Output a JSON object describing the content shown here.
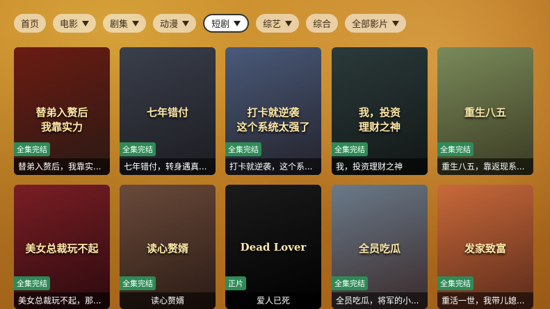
{
  "nav": {
    "tabs": [
      {
        "label": "首页",
        "dropdown": false,
        "active": false
      },
      {
        "label": "电影",
        "dropdown": true,
        "active": false
      },
      {
        "label": "剧集",
        "dropdown": true,
        "active": false
      },
      {
        "label": "动漫",
        "dropdown": true,
        "active": false
      },
      {
        "label": "短剧",
        "dropdown": true,
        "active": true
      },
      {
        "label": "综艺",
        "dropdown": true,
        "active": false
      },
      {
        "label": "综合",
        "dropdown": false,
        "active": false
      },
      {
        "label": "全部影片",
        "dropdown": true,
        "active": false
      }
    ]
  },
  "cards": [
    {
      "status": "全集完结",
      "title": "替弟入赘后，我靠实...",
      "poster_text": "替弟入赘后\n我靠实力",
      "colors": [
        "#6b1b12",
        "#2a1a14"
      ]
    },
    {
      "status": "全集完结",
      "title": "七年错付，转身遇真...",
      "poster_text": "七年错付",
      "colors": [
        "#3a3f4a",
        "#1c1c22"
      ]
    },
    {
      "status": "全集完结",
      "title": "打卡就逆袭，这个系...",
      "poster_text": "打卡就逆袭\n这个系统太强了",
      "colors": [
        "#4a5a7a",
        "#23222a"
      ]
    },
    {
      "status": "全集完结",
      "title": "我，投资理财之神",
      "poster_text": "我，投资\n理财之神",
      "colors": [
        "#2b3a3a",
        "#121616"
      ]
    },
    {
      "status": "全集完结",
      "title": "重生八五，靠返现系...",
      "poster_text": "重生八五",
      "colors": [
        "#7a8a5a",
        "#3a3a22"
      ]
    },
    {
      "status": "全集完结",
      "title": "美女总裁玩不起，那...",
      "poster_text": "美女总裁玩不起",
      "colors": [
        "#7a1e24",
        "#2a0a0e"
      ]
    },
    {
      "status": "全集完结",
      "title": "读心赘婿",
      "poster_text": "读心赘婿",
      "colors": [
        "#6a4a3a",
        "#2a1a14"
      ]
    },
    {
      "status": "正片",
      "title": "爱人已死",
      "poster_text": "Dead Lover",
      "colors": [
        "#1b1b1b",
        "#000000"
      ]
    },
    {
      "status": "全集完结",
      "title": "全员吃瓜，将军的小...",
      "poster_text": "全员吃瓜",
      "colors": [
        "#6a7a8a",
        "#3a2a2a"
      ]
    },
    {
      "status": "全集完结",
      "title": "重活一世，我带儿媳...",
      "poster_text": "发家致富",
      "colors": [
        "#c96a3a",
        "#5a2a1a"
      ]
    }
  ]
}
